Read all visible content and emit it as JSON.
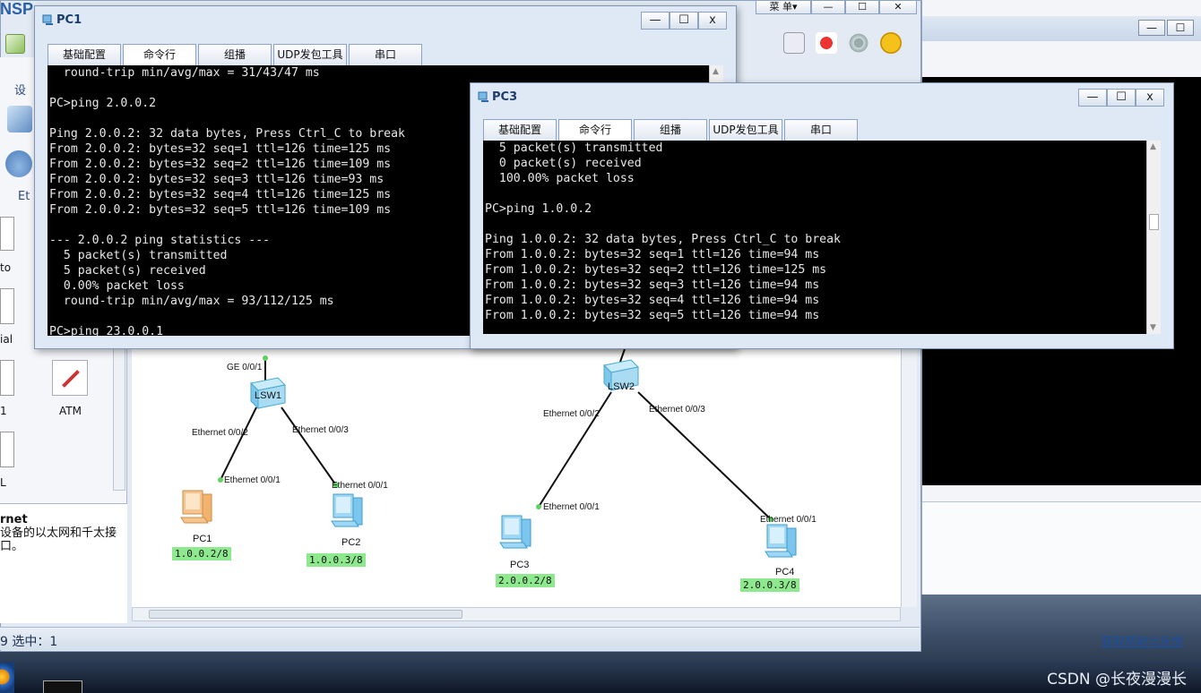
{
  "app": {
    "logo": "NSP",
    "window_title": ""
  },
  "main_menu": {
    "menu_label": "菜 单▾",
    "min": "—",
    "max": "☐",
    "close": "✕"
  },
  "toolbar_icons": [
    "chat-icon",
    "huawei-logo-icon",
    "settings-icon",
    "help-icon"
  ],
  "left_panel": {
    "tab_label": "设",
    "tab_label2": "Et",
    "devices": [
      {
        "label": "to"
      },
      {
        "label": "ial"
      },
      {
        "label": "1"
      },
      {
        "label": "ATM"
      },
      {
        "label": "L"
      }
    ],
    "desc_title": "rnet",
    "desc_text": "设备的以太网和千太接口。"
  },
  "statusbar": {
    "left": "9  选中：1",
    "help_link": "获取帮助与反馈"
  },
  "topology": {
    "switches": [
      {
        "name": "LSW1"
      },
      {
        "name": "LSW2"
      }
    ],
    "pcs": [
      {
        "name": "PC1",
        "ip": "1.0.0.2/8"
      },
      {
        "name": "PC2",
        "ip": "1.0.0.3/8"
      },
      {
        "name": "PC3",
        "ip": "2.0.0.2/8"
      },
      {
        "name": "PC4",
        "ip": "2.0.0.3/8"
      }
    ],
    "ports": {
      "lsw1_up": "GE 0/0/1",
      "lsw1_e2": "Ethernet 0/0/2",
      "lsw1_e3": "Ethernet 0/0/3",
      "pc1_e1": "Ethernet 0/0/1",
      "pc2_e1": "Ethernet 0/0/1",
      "lsw2_e2": "Ethernet 0/0/2",
      "lsw2_e3": "Ethernet 0/0/3",
      "pc3_e1": "Ethernet 0/0/1",
      "pc4_e1": "Ethernet 0/0/1"
    }
  },
  "pc1_window": {
    "title": "PC1",
    "tabs": [
      "基础配置",
      "命令行",
      "组播",
      "UDP发包工具",
      "串口"
    ],
    "active_tab": "命令行",
    "terminal": "  round-trip min/avg/max = 31/43/47 ms\n\nPC>ping 2.0.0.2\n\nPing 2.0.0.2: 32 data bytes, Press Ctrl_C to break\nFrom 2.0.0.2: bytes=32 seq=1 ttl=126 time=125 ms\nFrom 2.0.0.2: bytes=32 seq=2 ttl=126 time=109 ms\nFrom 2.0.0.2: bytes=32 seq=3 ttl=126 time=93 ms\nFrom 2.0.0.2: bytes=32 seq=4 ttl=126 time=125 ms\nFrom 2.0.0.2: bytes=32 seq=5 ttl=126 time=109 ms\n\n--- 2.0.0.2 ping statistics ---\n  5 packet(s) transmitted\n  5 packet(s) received\n  0.00% packet loss\n  round-trip min/avg/max = 93/112/125 ms\n\nPC>ping 23.0.0.1"
  },
  "pc3_window": {
    "title": "PC3",
    "tabs": [
      "基础配置",
      "命令行",
      "组播",
      "UDP发包工具",
      "串口"
    ],
    "active_tab": "命令行",
    "terminal": "  5 packet(s) transmitted\n  0 packet(s) received\n  100.00% packet loss\n\nPC>ping 1.0.0.2\n\nPing 1.0.0.2: 32 data bytes, Press Ctrl_C to break\nFrom 1.0.0.2: bytes=32 seq=1 ttl=126 time=94 ms\nFrom 1.0.0.2: bytes=32 seq=2 ttl=126 time=125 ms\nFrom 1.0.0.2: bytes=32 seq=3 ttl=126 time=94 ms\nFrom 1.0.0.2: bytes=32 seq=4 ttl=126 time=94 ms\nFrom 1.0.0.2: bytes=32 seq=5 ttl=126 time=94 ms"
  },
  "window_buttons": {
    "min": "—",
    "max": "☐",
    "close": "x"
  },
  "watermark": "CSDN @长夜漫漫长",
  "colors": {
    "ip_badge": "#8ee88e",
    "terminal_bg": "#000000",
    "link_dot": "#5fd35f"
  }
}
